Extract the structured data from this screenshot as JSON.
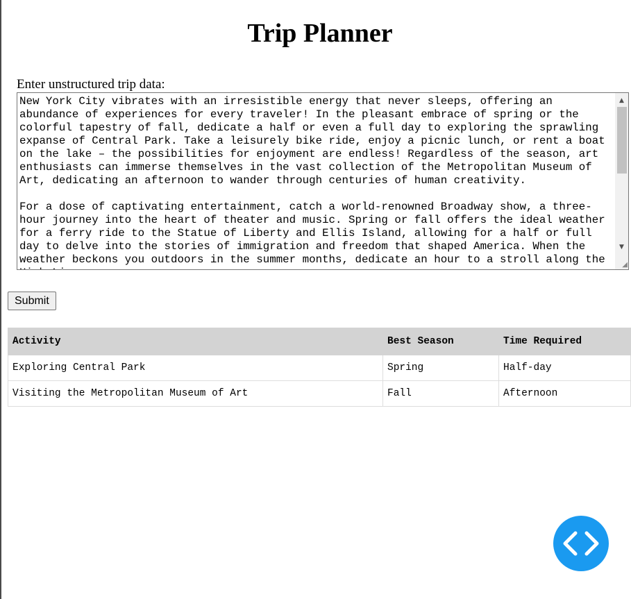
{
  "page": {
    "title": "Trip Planner"
  },
  "input": {
    "label": "Enter unstructured trip data:",
    "value": "New York City vibrates with an irresistible energy that never sleeps, offering an abundance of experiences for every traveler! In the pleasant embrace of spring or the colorful tapestry of fall, dedicate a half or even a full day to exploring the sprawling expanse of Central Park. Take a leisurely bike ride, enjoy a picnic lunch, or rent a boat on the lake – the possibilities for enjoyment are endless! Regardless of the season, art enthusiasts can immerse themselves in the vast collection of the Metropolitan Museum of Art, dedicating an afternoon to wander through centuries of human creativity.\n\nFor a dose of captivating entertainment, catch a world-renowned Broadway show, a three-hour journey into the heart of theater and music. Spring or fall offers the ideal weather for a ferry ride to the Statue of Liberty and Ellis Island, allowing for a half or full day to delve into the stories of immigration and freedom that shaped America. When the weather beckons you outdoors in the summer months, dedicate an hour to a stroll along the High Line,"
  },
  "form": {
    "submit_label": "Submit"
  },
  "table": {
    "headers": [
      "Activity",
      "Best Season",
      "Time Required"
    ],
    "rows": [
      [
        "Exploring Central Park",
        "Spring",
        "Half-day"
      ],
      [
        "Visiting the Metropolitan Museum of Art",
        "Fall",
        "Afternoon"
      ]
    ]
  },
  "icons": {
    "fab": "code-icon",
    "scroll_up": "scroll-up-arrow-icon",
    "scroll_down": "scroll-down-arrow-icon",
    "resize": "resize-grip-icon"
  },
  "colors": {
    "fab_background": "#1a9af0",
    "table_header_background": "#d3d3d3"
  }
}
